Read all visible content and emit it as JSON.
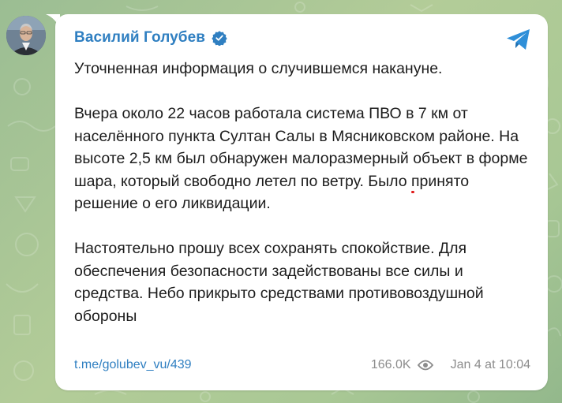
{
  "post": {
    "author": "Василий Голубев",
    "paragraphs": [
      {
        "text": "Уточненная информация о случившемся накануне."
      },
      {
        "before": "Вчера около 22 часов работала система ПВО в 7 км от населённого пункта Султан Салы в Мясниковском районе. На высоте 2,5 км был обнаружен малоразмерный ",
        "highlight": "объект в форме шара",
        "after": ", который свободно летел по ветру. Было принято решение о его ликвидации."
      },
      {
        "text": "Настоятельно прошу всех сохранять спокойствие. Для обеспечения безопасности задействованы все силы и средства. Небо прикрыто средствами противовоздушной обороны"
      }
    ],
    "link": "t.me/golubev_vu/439",
    "views": "166.0K",
    "date": "Jan 4 at 10:04"
  },
  "icons": {
    "verified": "verified-badge-icon",
    "share": "telegram-share-icon",
    "views": "eye-icon"
  },
  "colors": {
    "accent": "#2f7fc1",
    "highlight_underline": "#e01818",
    "meta_text": "#8c8c8c"
  }
}
